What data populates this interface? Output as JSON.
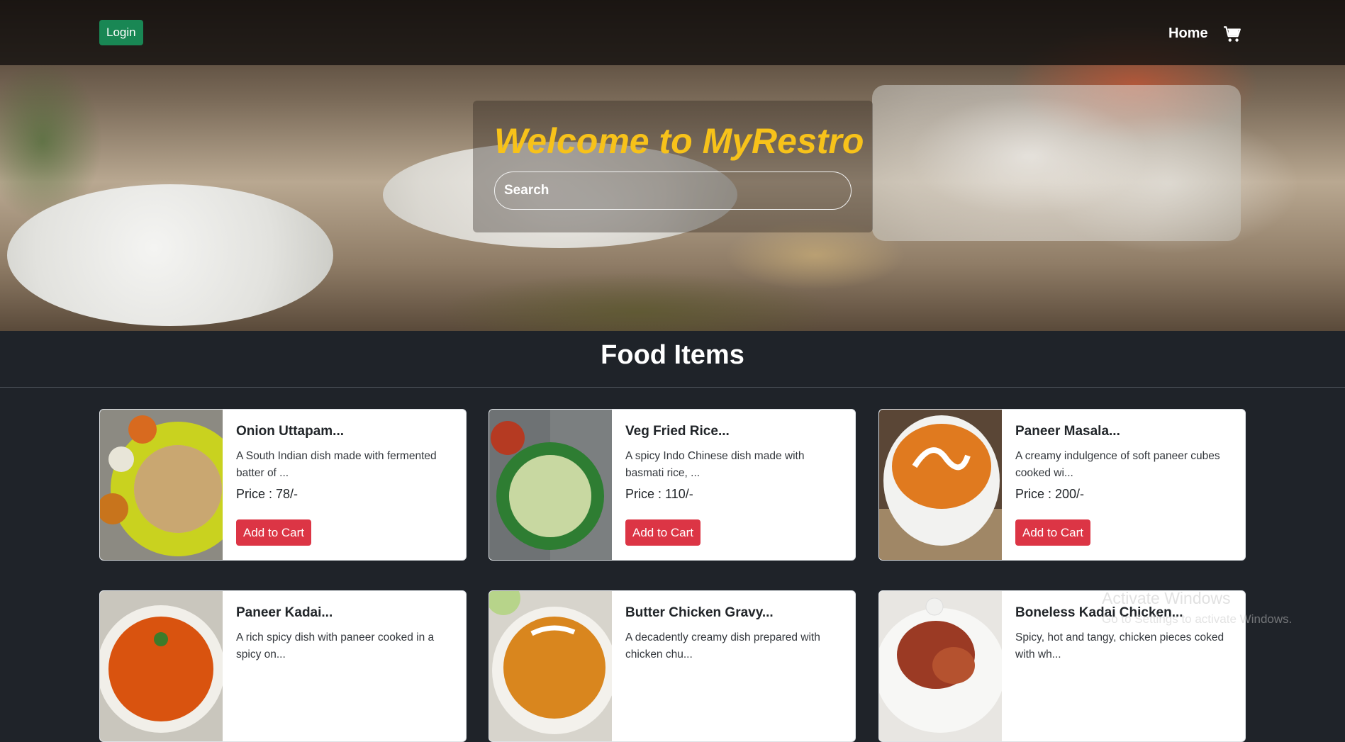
{
  "nav": {
    "login_label": "Login",
    "home_label": "Home",
    "cart_icon": "cart-icon"
  },
  "hero": {
    "title": "Welcome to MyRestro",
    "search_placeholder": "Search"
  },
  "section": {
    "title": "Food Items"
  },
  "colors": {
    "login": "#198754",
    "welcome": "#f7c21a",
    "add_to_cart": "#dc3545",
    "page_bg": "#1f2329"
  },
  "items": [
    {
      "name": "Onion Uttapam...",
      "desc": "A South Indian dish made with fermented batter of ...",
      "price": "Price : 78/-",
      "button": "Add to Cart"
    },
    {
      "name": "Veg Fried Rice...",
      "desc": "A spicy Indo Chinese dish made with basmati rice, ...",
      "price": "Price : 110/-",
      "button": "Add to Cart"
    },
    {
      "name": "Paneer Masala...",
      "desc": "A creamy indulgence of soft paneer cubes cooked wi...",
      "price": "Price : 200/-",
      "button": "Add to Cart"
    },
    {
      "name": "Paneer Kadai...",
      "desc": "A rich spicy dish with paneer cooked in a spicy on...",
      "price": "",
      "button": ""
    },
    {
      "name": "Butter Chicken Gravy...",
      "desc": "A decadently creamy dish prepared with chicken chu...",
      "price": "",
      "button": ""
    },
    {
      "name": "Boneless Kadai Chicken...",
      "desc": "Spicy, hot and tangy, chicken pieces coked with wh...",
      "price": "",
      "button": ""
    }
  ],
  "watermark": {
    "line1": "Activate Windows",
    "line2": "Go to Settings to activate Windows."
  }
}
